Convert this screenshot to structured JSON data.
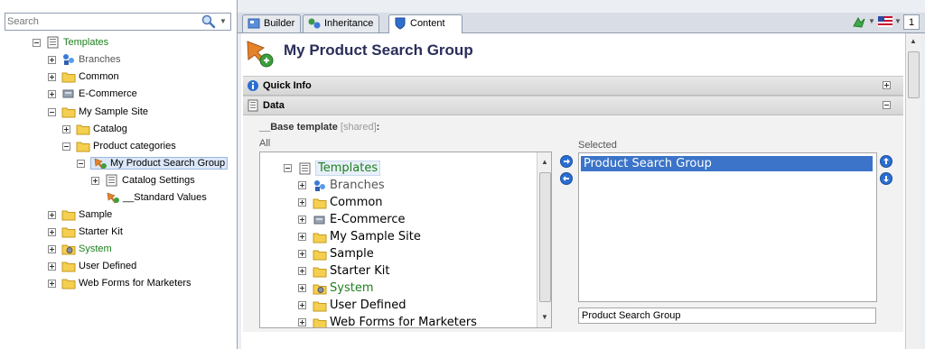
{
  "search": {
    "placeholder": "Search"
  },
  "left_tree": {
    "root": "Templates",
    "items": [
      {
        "label": "Branches",
        "style": "grey"
      },
      {
        "label": "Common"
      },
      {
        "label": "E-Commerce"
      },
      {
        "label": "My Sample Site"
      },
      {
        "label": "Catalog"
      },
      {
        "label": "Product categories"
      },
      {
        "label": "My Product Search Group"
      },
      {
        "label": "Catalog Settings"
      },
      {
        "label": "__Standard Values"
      },
      {
        "label": "Sample"
      },
      {
        "label": "Starter Kit"
      },
      {
        "label": "System",
        "style": "green"
      },
      {
        "label": "User Defined"
      },
      {
        "label": "Web Forms for Marketers"
      }
    ]
  },
  "tabs": [
    {
      "label": "Builder"
    },
    {
      "label": "Inheritance"
    },
    {
      "label": "Content",
      "active": true
    }
  ],
  "item_title": "My Product Search Group",
  "sections": {
    "quick_info": "Quick Info",
    "data": "Data"
  },
  "field": {
    "label": "__Base template",
    "shared": "[shared]",
    "colon": ":",
    "all_label": "All",
    "selected_label": "Selected"
  },
  "all_tree": {
    "root": "Templates",
    "items": [
      "Branches",
      "Common",
      "E-Commerce",
      "My Sample Site",
      "Sample",
      "Starter Kit",
      "System",
      "User Defined",
      "Web Forms for Marketers"
    ]
  },
  "selected_items": [
    "Product Search Group"
  ],
  "selected_text": "Product Search Group",
  "top_right": {
    "page_indicator": "1"
  },
  "colors": {
    "accent": "#2a6ed1",
    "green_text": "#1d7f1d",
    "selection": "#3b74c8"
  }
}
